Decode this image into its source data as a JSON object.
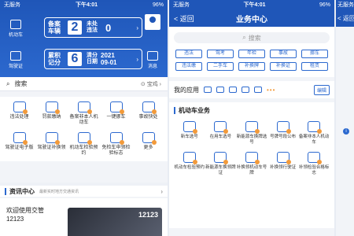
{
  "screen1": {
    "status": {
      "carrier": "无服务",
      "time": "下午4:01",
      "battery": "96%"
    },
    "side_left": [
      {
        "label": "机动车",
        "icon": "car-icon"
      },
      {
        "label": "驾驶证",
        "icon": "license-icon"
      }
    ],
    "side_right": [
      {
        "label": "",
        "icon": "avatar-icon"
      },
      {
        "label": "消息",
        "icon": "mail-icon"
      }
    ],
    "card_vehicle": {
      "label": "备案车辆",
      "count": "2",
      "label2": "未处违法",
      "value": "0"
    },
    "card_points": {
      "label": "累积记分",
      "count": "6",
      "label2": "清分日期",
      "value": "2021 09-01"
    },
    "search": {
      "placeholder": "搜索",
      "location": "宝鸡"
    },
    "services": [
      {
        "label": "违法处理"
      },
      {
        "label": "罚款缴纳"
      },
      {
        "label": "备案非本人机动车"
      },
      {
        "label": "一键挪车"
      },
      {
        "label": "事故快处"
      },
      {
        "label": "驾驶证电子版"
      },
      {
        "label": "驾驶证补换领"
      },
      {
        "label": "机动车检验预约"
      },
      {
        "label": "免检车申领检验标志"
      },
      {
        "label": "更多"
      }
    ],
    "news": {
      "title": "资讯中心",
      "subtitle": "最新实时地方交通资讯",
      "item": "欢迎使用交管12123",
      "thumb_text": "12123"
    }
  },
  "screen2": {
    "status": {
      "carrier": "无服务",
      "time": "下午4:01",
      "battery": "96%"
    },
    "nav": {
      "back": "< 返回",
      "title": "业务中心"
    },
    "search": {
      "placeholder": "搜索"
    },
    "tags": [
      "违法",
      "驾考",
      "年检",
      "事故",
      "挪车",
      "违法缴",
      "二手车",
      "补换牌",
      "补换证",
      "租赁"
    ],
    "my_apps": {
      "label": "我的应用",
      "more": "•••",
      "edit": "编辑"
    },
    "section": {
      "title": "机动车业务",
      "items": [
        "新车选号",
        "在用车选号",
        "新能源车换牌选号",
        "号牌号段公布",
        "备案非本人机动车",
        "机动车检验预约",
        "新能源车换领牌证",
        "补换领机动车号牌",
        "补换领行驶证",
        "补领检验合格标志"
      ]
    }
  },
  "screen3": {
    "status": {
      "carrier": "无服务"
    },
    "nav": {
      "back": "< 返回"
    },
    "info": "i"
  }
}
